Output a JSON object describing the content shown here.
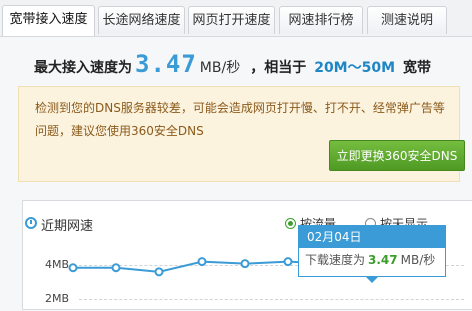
{
  "tabs": [
    {
      "label": "宽带接入速度",
      "active": true
    },
    {
      "label": "长途网络速度",
      "active": false
    },
    {
      "label": "网页打开速度",
      "active": false
    },
    {
      "label": "网速排行榜",
      "active": false
    },
    {
      "label": "测速说明",
      "active": false
    }
  ],
  "headline": {
    "prefix": "最大接入速度为",
    "speed": "3.47",
    "unit": "MB/秒",
    "middle": "，相当于",
    "bandwidth": "20M～50M",
    "suffix": "宽带"
  },
  "notice": {
    "text": "检测到您的DNS服务器较差，可能会造成网页打开慢、打不开、经常弹广告等问题，建议您使用360安全DNS",
    "button": "立即更换360安全DNS"
  },
  "chart": {
    "title": "近期网速",
    "radio1": "按流量",
    "radio2": "按天显示",
    "y_ticks": [
      "4MB",
      "2MB"
    ],
    "tooltip_date": "02月04日",
    "tooltip_label": "下载速度为",
    "tooltip_value": "3.47",
    "tooltip_unit": "MB/秒"
  },
  "chart_data": {
    "type": "line",
    "values": [
      3.3,
      3.3,
      3.2,
      3.45,
      3.4,
      3.45,
      3.4,
      3.47
    ],
    "ylim": [
      1.8,
      4.2
    ]
  },
  "colors": {
    "accent": "#3a9bd6",
    "button_green": "#4f9a24",
    "notice_bg": "#fcf3df"
  }
}
